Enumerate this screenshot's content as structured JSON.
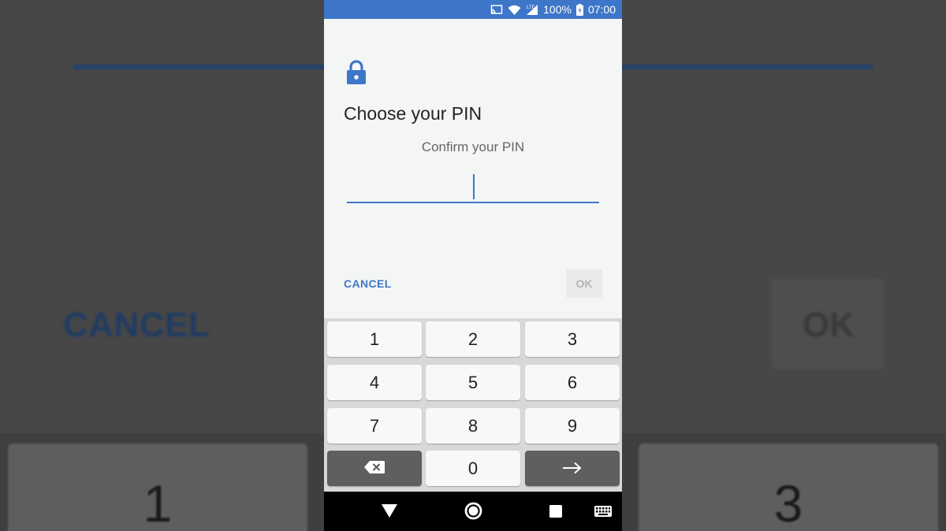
{
  "status_bar": {
    "battery": "100%",
    "time": "07:00"
  },
  "dialog": {
    "title": "Choose your PIN",
    "subtitle": "Confirm your PIN",
    "pin_value": "",
    "cancel_label": "CANCEL",
    "ok_label": "OK"
  },
  "keypad": {
    "keys": [
      "1",
      "2",
      "3",
      "4",
      "5",
      "6",
      "7",
      "8",
      "9",
      "0"
    ]
  },
  "background": {
    "cancel_label": "CANCEL",
    "ok_label": "OK",
    "key_left": "1",
    "key_right": "3"
  },
  "colors": {
    "accent": "#3e77c9",
    "status_bar": "#3e77c9",
    "dark_key": "#5f5f5f"
  },
  "icons": [
    "cast-icon",
    "wifi-icon",
    "signal-icon",
    "battery-icon",
    "lock-icon",
    "backspace-icon",
    "enter-arrow-icon",
    "back-icon",
    "home-icon",
    "recents-icon",
    "keyboard-icon"
  ]
}
